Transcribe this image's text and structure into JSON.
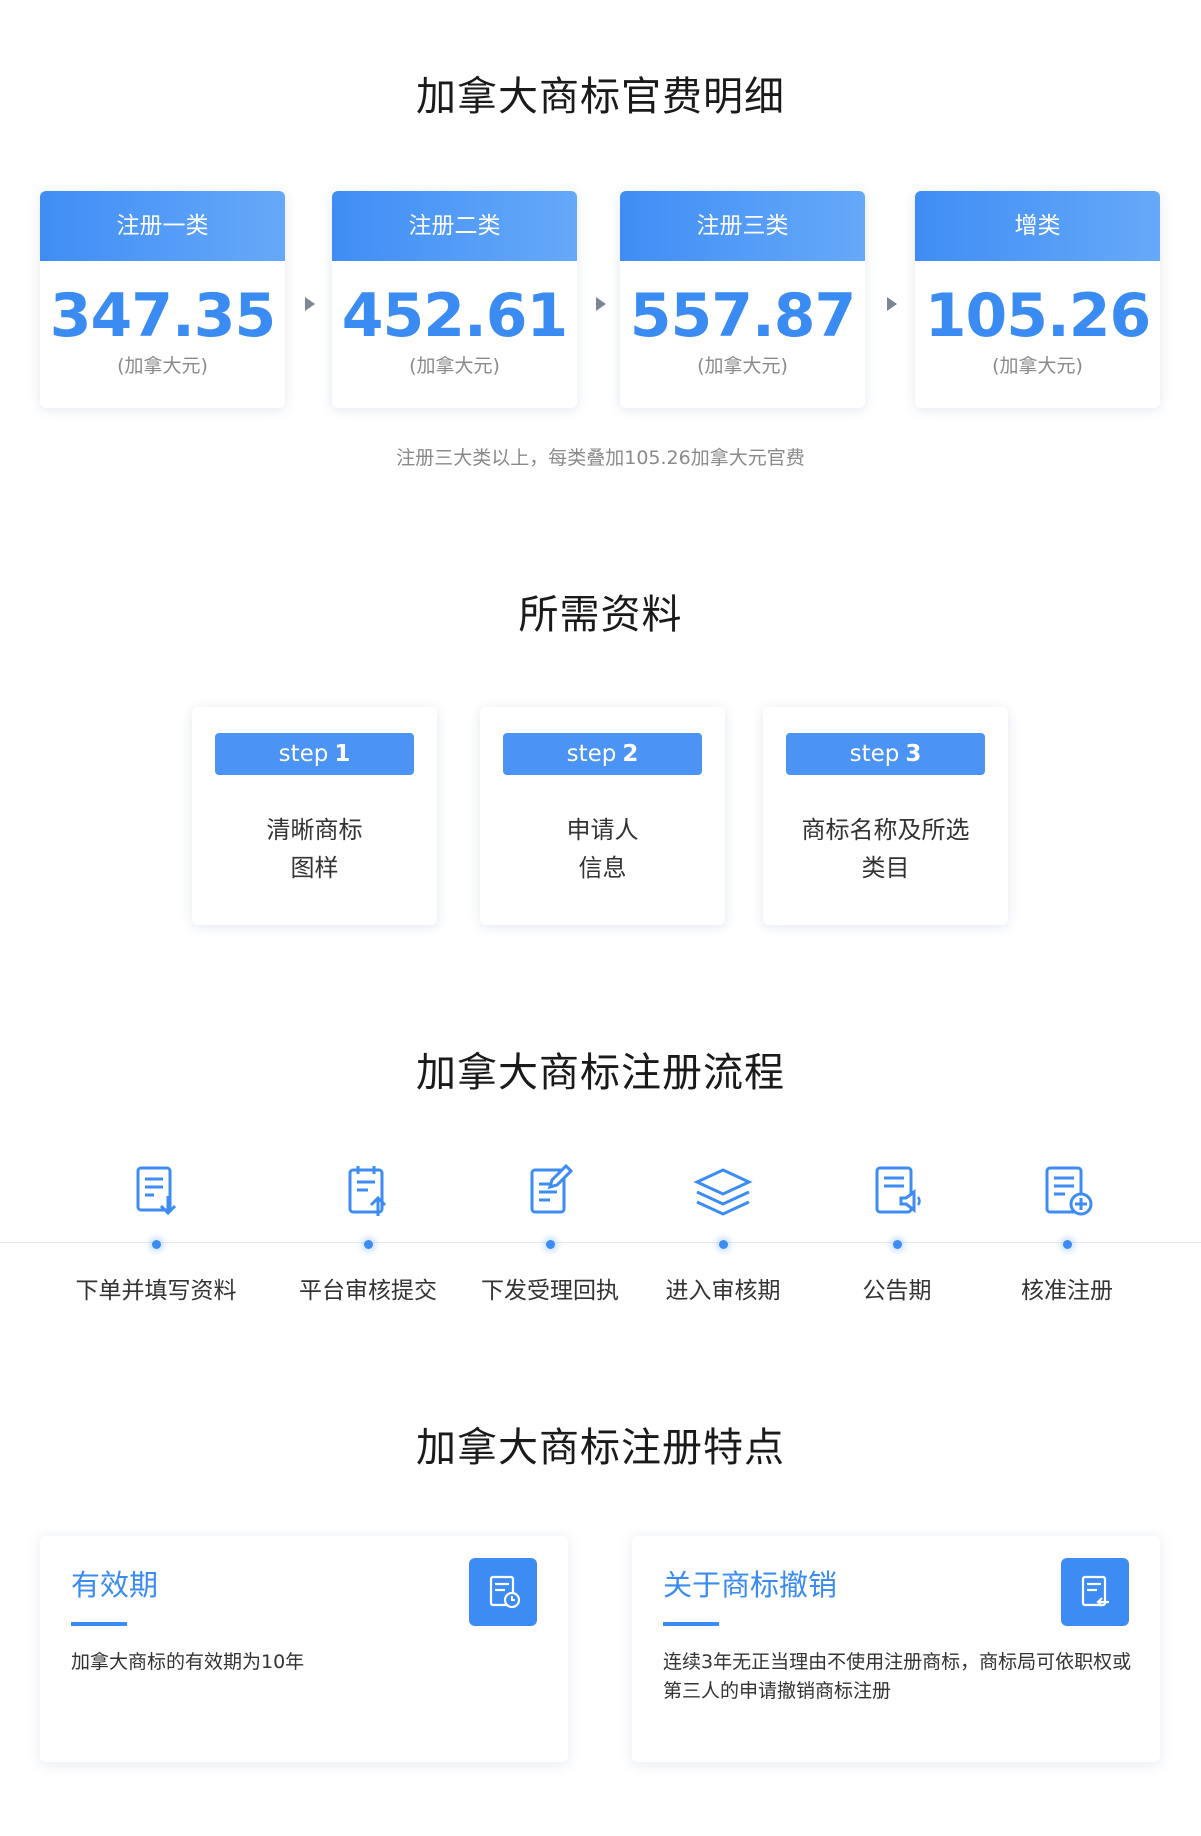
{
  "fees": {
    "title": "加拿大商标官费明细",
    "cards": [
      {
        "label": "注册一类",
        "price": "347.35",
        "unit": "(加拿大元)"
      },
      {
        "label": "注册二类",
        "price": "452.61",
        "unit": "(加拿大元)"
      },
      {
        "label": "注册三类",
        "price": "557.87",
        "unit": "(加拿大元)"
      },
      {
        "label": "增类",
        "price": "105.26",
        "unit": "(加拿大元)"
      }
    ],
    "note": "注册三大类以上，每类叠加105.26加拿大元官费"
  },
  "materials": {
    "title": "所需资料",
    "steps": [
      {
        "prefix": "step",
        "num": "1",
        "line1": "清晰商标",
        "line2": "图样"
      },
      {
        "prefix": "step",
        "num": "2",
        "line1": "申请人",
        "line2": "信息"
      },
      {
        "prefix": "step",
        "num": "3",
        "line1": "商标名称及所选",
        "line2": "类目"
      }
    ]
  },
  "process": {
    "title": "加拿大商标注册流程",
    "steps": [
      {
        "label": "下单并填写资料",
        "icon": "document-download-icon"
      },
      {
        "label": "平台审核提交",
        "icon": "document-upload-icon"
      },
      {
        "label": "下发受理回执",
        "icon": "document-edit-icon"
      },
      {
        "label": "进入审核期",
        "icon": "layers-icon"
      },
      {
        "label": "公告期",
        "icon": "document-announce-icon"
      },
      {
        "label": "核准注册",
        "icon": "document-add-icon"
      }
    ]
  },
  "features": {
    "title": "加拿大商标注册特点",
    "cards": [
      {
        "title": "有效期",
        "text": "加拿大商标的有效期为10年",
        "icon": "document-clock-icon"
      },
      {
        "title": "关于商标撤销",
        "text": "连续3年无正当理由不使用注册商标，商标局可依职权或第三人的申请撤销商标注册",
        "icon": "document-undo-icon"
      }
    ]
  },
  "colors": {
    "accent": "#3a8bf2",
    "text": "#333333",
    "muted": "#8a8a8a"
  }
}
